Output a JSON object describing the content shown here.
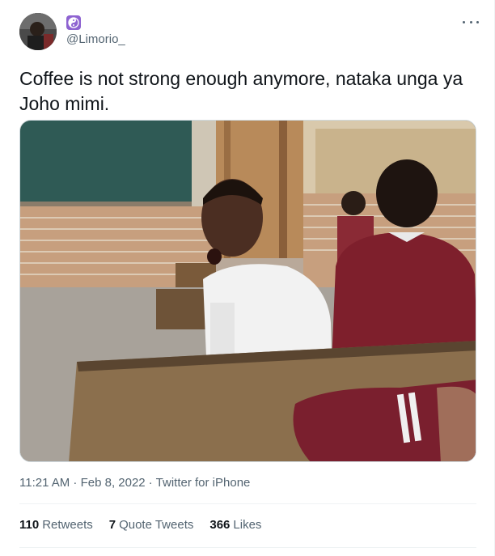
{
  "tweet": {
    "author": {
      "handle": "@Limorio_",
      "badge_icon": "yin-yang-icon",
      "badge_color": "#8e63d1"
    },
    "text": "Coffee is not strong enough anymore, nataka unga ya Joho mimi.",
    "timestamp": "11:21 AM · Feb 8, 2022",
    "source": "Twitter for iPhone",
    "stats": [
      {
        "count": "110",
        "label": "Retweets"
      },
      {
        "count": "7",
        "label": "Quote Tweets"
      },
      {
        "count": "366",
        "label": "Likes"
      }
    ]
  },
  "colors": {
    "text_primary": "#0f1419",
    "text_secondary": "#536471",
    "border": "#eff3f4"
  }
}
